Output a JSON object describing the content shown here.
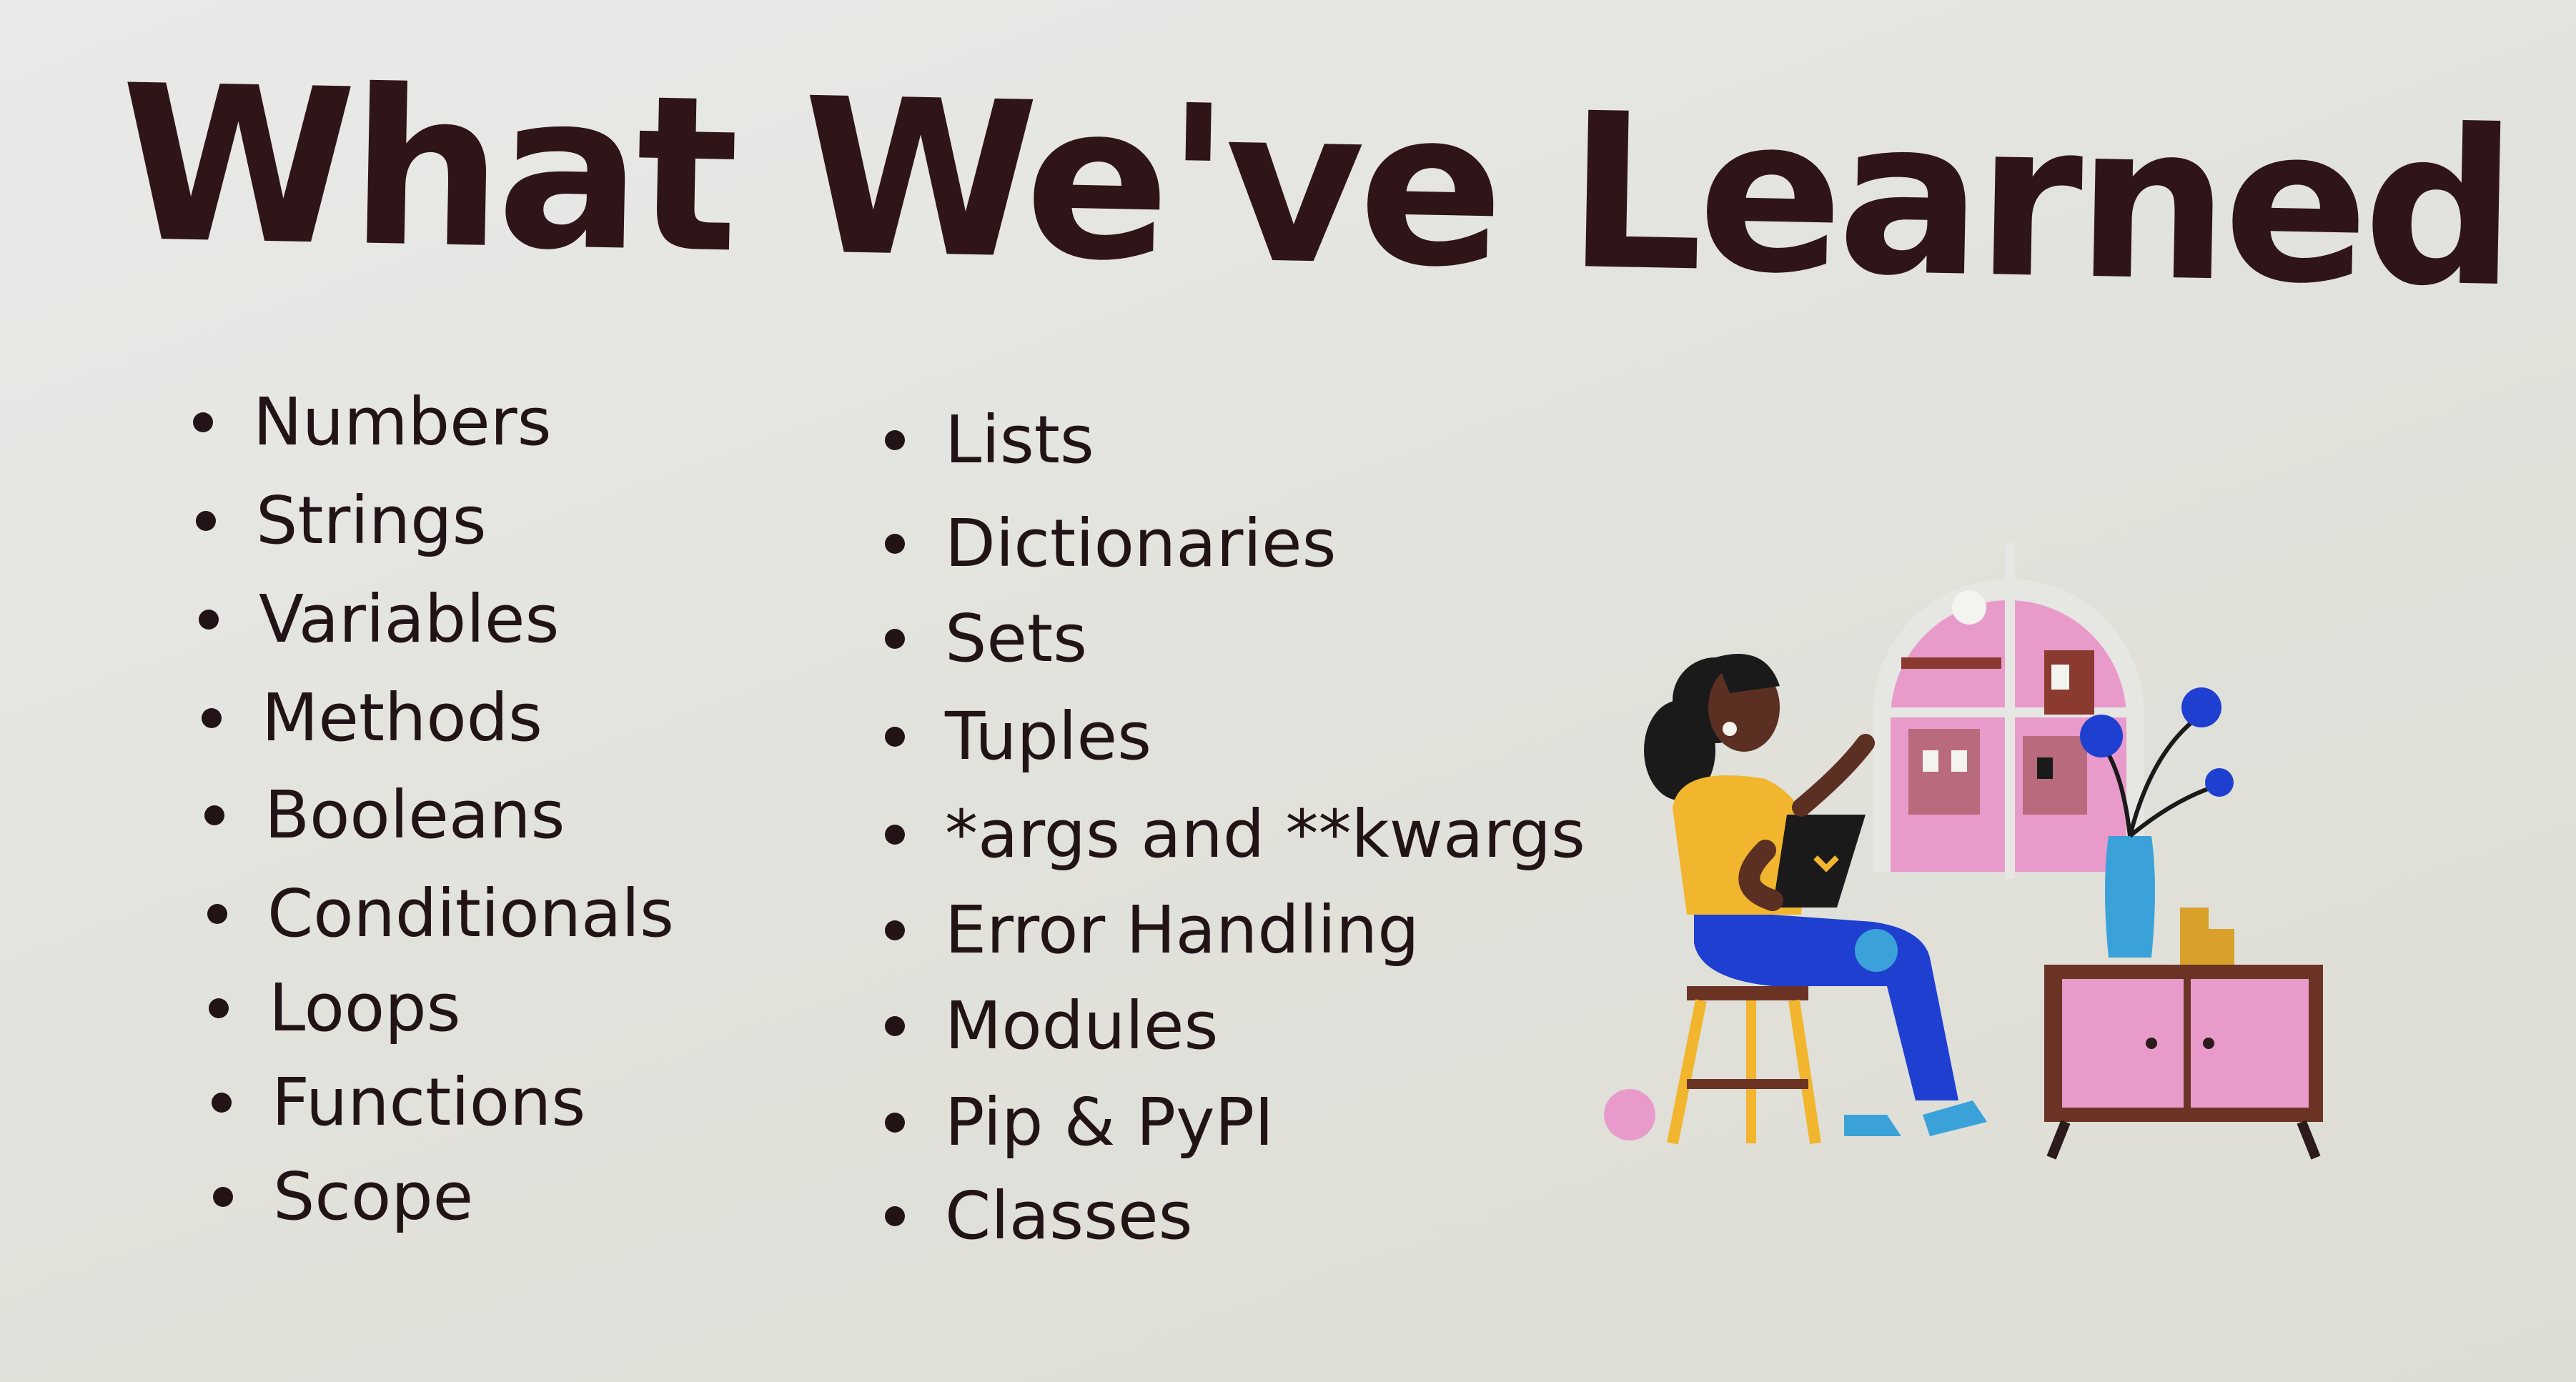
{
  "slide": {
    "title": "What We've Learned",
    "column_left": [
      "Numbers",
      "Strings",
      "Variables",
      "Methods",
      "Booleans",
      "Conditionals",
      "Loops",
      "Functions",
      "Scope"
    ],
    "column_right": [
      "Lists",
      "Dictionaries",
      "Sets",
      "Tuples",
      "*args and **kwargs",
      "Error Handling",
      "Modules",
      "Pip & PyPI",
      "Classes"
    ]
  },
  "illustration": {
    "icon": "woman-with-laptop-illustration",
    "colors": {
      "window": "#e89bcb",
      "shirt": "#f1b52e",
      "pants": "#1f3fd1",
      "cabinet": "#6b3324",
      "vase": "#3aa2d8"
    }
  }
}
